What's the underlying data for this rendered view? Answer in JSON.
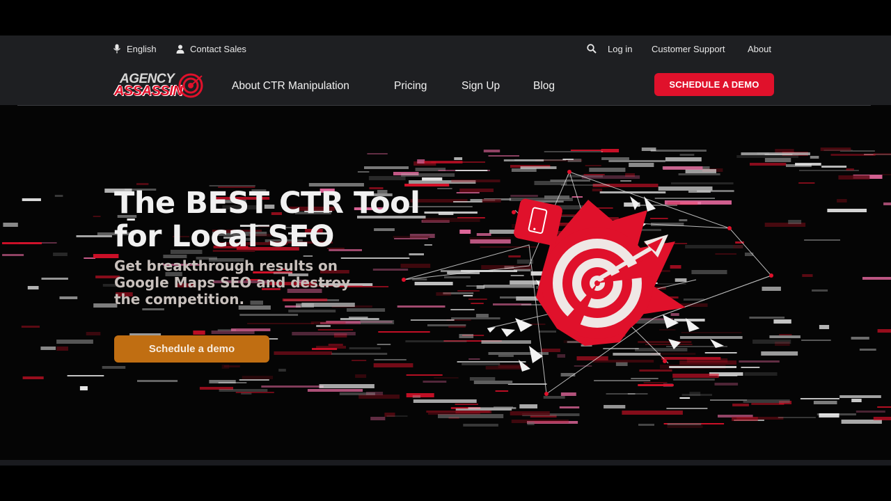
{
  "topbar": {
    "language": "English",
    "contact_sales": "Contact Sales",
    "log_in": "Log in",
    "customer_support": "Customer Support",
    "about": "About"
  },
  "logo": {
    "line1": "AGENCY",
    "line2": "ASSASSIN"
  },
  "nav": {
    "items": [
      {
        "label": "About CTR Manipulation"
      },
      {
        "label": "Pricing"
      },
      {
        "label": "Sign Up"
      },
      {
        "label": "Blog"
      }
    ],
    "cta_label": "SCHEDULE A DEMO"
  },
  "hero": {
    "headline_line1": "The BEST CTR Tool",
    "headline_line2": "for Local SEO",
    "sub_line1": "Get breakthrough results on",
    "sub_line2": "Google Maps SEO and destroy",
    "sub_line3": "the competition.",
    "button_label": "Schedule a demo"
  },
  "colors": {
    "brand_red": "#e0112b",
    "button_orange": "#c06e12",
    "header_bg": "#1e1f22"
  },
  "icons": {
    "language": "microphone-icon",
    "contact": "person-icon",
    "search": "search-icon",
    "hero_art": "target-with-arrow-icon",
    "phone": "smartphone-icon"
  }
}
